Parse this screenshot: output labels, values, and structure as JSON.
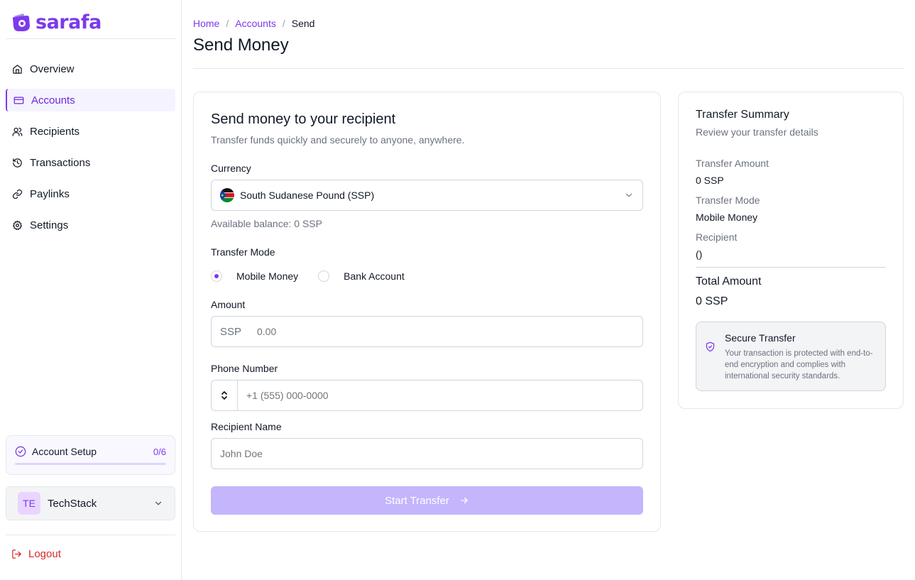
{
  "brand": {
    "name": "sarafa",
    "accent": "#7c3aed"
  },
  "sidebar": {
    "items": [
      {
        "label": "Overview",
        "icon": "home-icon",
        "active": false
      },
      {
        "label": "Accounts",
        "icon": "card-icon",
        "active": true
      },
      {
        "label": "Recipients",
        "icon": "users-icon",
        "active": false
      },
      {
        "label": "Transactions",
        "icon": "history-icon",
        "active": false
      },
      {
        "label": "Paylinks",
        "icon": "link-icon",
        "active": false
      },
      {
        "label": "Settings",
        "icon": "gear-icon",
        "active": false
      }
    ],
    "setup": {
      "title": "Account Setup",
      "count": "0/6",
      "progress": 0
    },
    "org": {
      "initials": "TE",
      "name": "TechStack"
    },
    "logout_label": "Logout"
  },
  "breadcrumb": {
    "home": "Home",
    "accounts": "Accounts",
    "current": "Send",
    "separator": "/"
  },
  "page": {
    "title": "Send Money"
  },
  "form": {
    "title": "Send money to your recipient",
    "subtitle": "Transfer funds quickly and securely to anyone, anywhere.",
    "currency_label": "Currency",
    "currency_value": "South Sudanese Pound (SSP)",
    "balance": "Available balance: 0 SSP",
    "mode_label": "Transfer Mode",
    "mode_options": [
      "Mobile Money",
      "Bank Account"
    ],
    "mode_selected": "Mobile Money",
    "amount_label": "Amount",
    "amount_prefix": "SSP",
    "amount_placeholder": "0.00",
    "phone_label": "Phone Number",
    "phone_placeholder": "+1 (555) 000-0000",
    "name_label": "Recipient Name",
    "name_placeholder": "John Doe",
    "submit_label": "Start Transfer"
  },
  "summary": {
    "title": "Transfer Summary",
    "subtitle": "Review your transfer details",
    "amount_label": "Transfer Amount",
    "amount_value": "0 SSP",
    "mode_label": "Transfer Mode",
    "mode_value": "Mobile Money",
    "recipient_label": "Recipient",
    "recipient_value": "()",
    "total_label": "Total Amount",
    "total_value": "0 SSP",
    "secure_title": "Secure Transfer",
    "secure_text": "Your transaction is protected with end-to-end encryption and complies with international security standards."
  }
}
